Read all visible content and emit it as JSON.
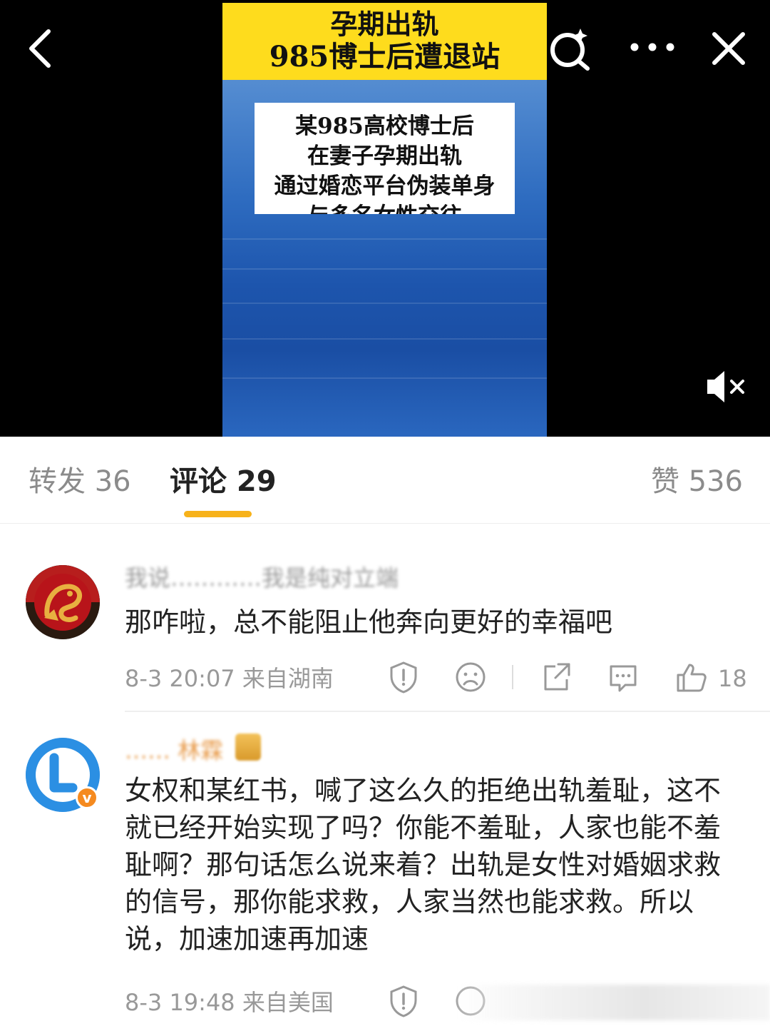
{
  "video": {
    "banner_line1": "孕期出轨",
    "banner_line2": "985博士后遭退站",
    "card_lines": [
      "某985高校博士后",
      "在妻子孕期出轨",
      "通过婚恋平台伪装单身",
      "与多名女性交往"
    ]
  },
  "toolbar": {
    "back_icon": "chevron-left-icon",
    "search_icon": "search-sparkle-icon",
    "more_icon": "more-dots-icon",
    "close_icon": "close-icon",
    "mute_icon": "speaker-muted-icon"
  },
  "tabs": {
    "repost": "转发 36",
    "comments": "评论 29",
    "likes": "赞 536",
    "accent_color": "#f7b21a"
  },
  "comments": [
    {
      "author": "我说…………我是纯对立端",
      "text": "那咋啦，总不能阻止他奔向更好的幸福吧",
      "time": "8-3 20:07 来自湖南",
      "likes": "18"
    },
    {
      "author": "…… 林霖",
      "avatar_letter": "L",
      "badge_letter": "v",
      "text": "女权和某红书，喊了这么久的拒绝出轨羞耻，这不就已经开始实现了吗？你能不羞耻，人家也能不羞耻啊？那句话怎么说来着？出轨是女性对婚姻求救的信号，那你能求救，人家当然也能求救。所以说，加速加速再加速",
      "time": "8-3 19:48 来自美国"
    }
  ]
}
